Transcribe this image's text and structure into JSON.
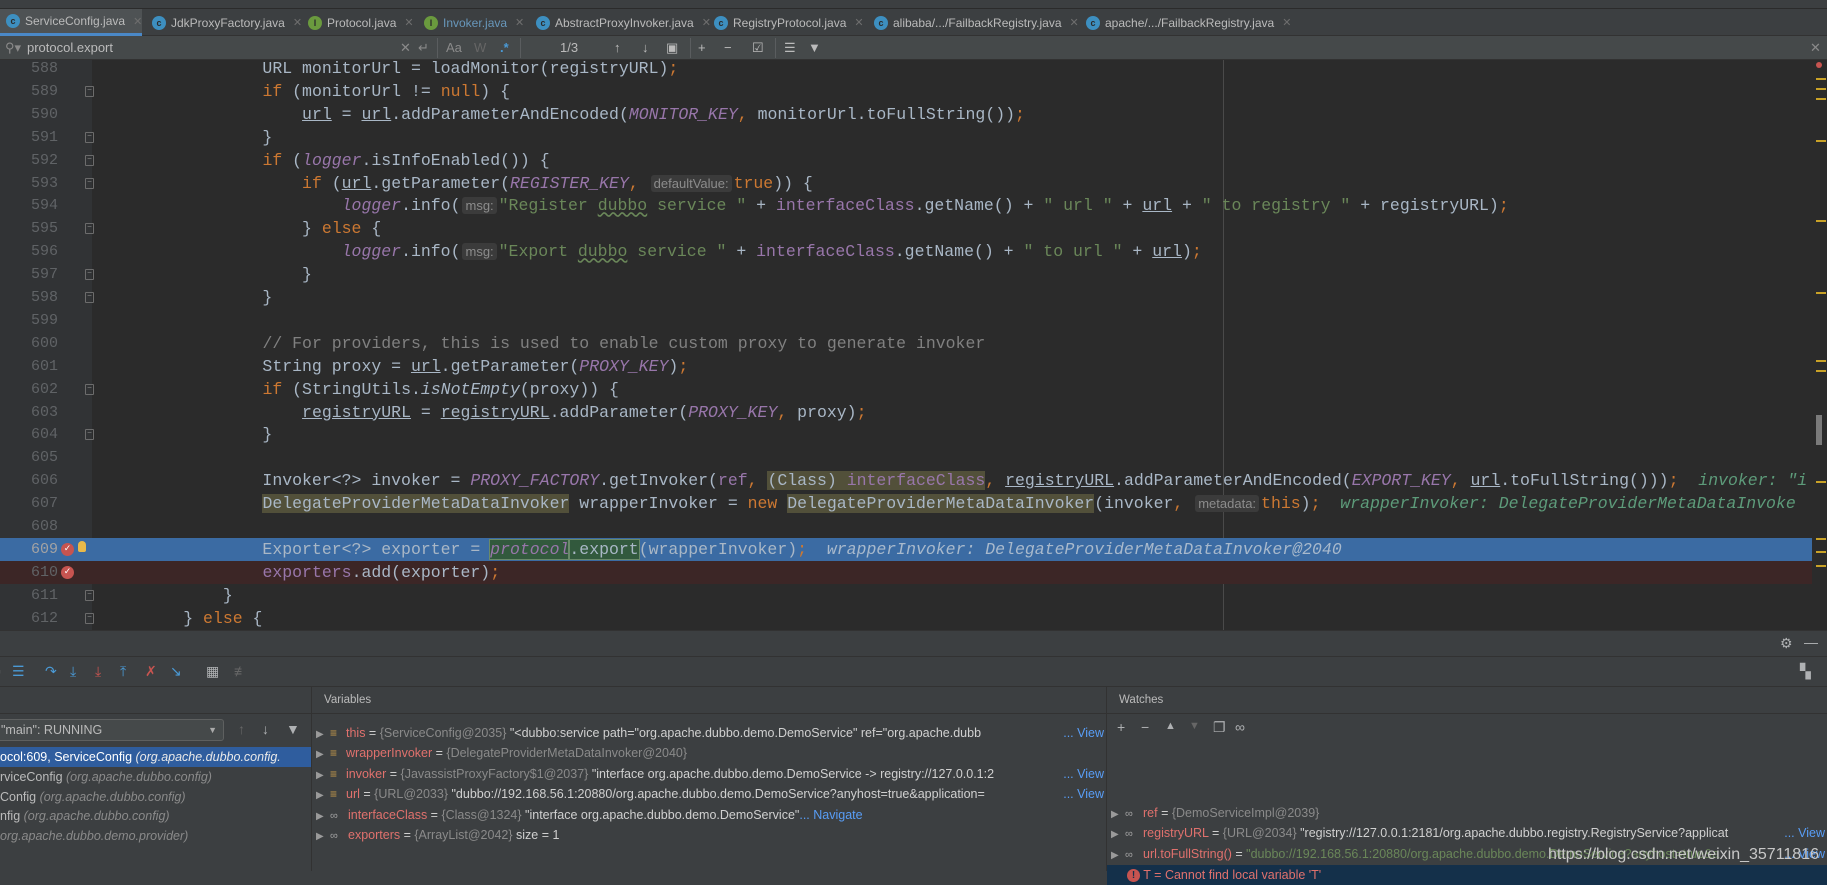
{
  "tabs": [
    {
      "label": "ServiceConfig.java",
      "icon": "c",
      "active": true
    },
    {
      "label": "JdkProxyFactory.java",
      "icon": "c"
    },
    {
      "label": "Protocol.java",
      "icon": "i"
    },
    {
      "label": "Invoker.java",
      "icon": "i",
      "modified": true
    },
    {
      "label": "AbstractProxyInvoker.java",
      "icon": "c"
    },
    {
      "label": "RegistryProtocol.java",
      "icon": "c"
    },
    {
      "label": "alibaba/.../FailbackRegistry.java",
      "icon": "c"
    },
    {
      "label": "apache/.../FailbackRegistry.java",
      "icon": "c"
    }
  ],
  "search": {
    "query": "protocol.export",
    "match_case": "Aa",
    "words": "W",
    "regex": ".*",
    "counter": "1/3"
  },
  "editor": {
    "lines": [
      {
        "n": "588",
        "t": [
          [
            "",
            "                URL monitorUrl = loadMonitor(registryURL)"
          ],
          [
            "kw",
            ";"
          ]
        ]
      },
      {
        "n": "589",
        "fold": true,
        "t": [
          [
            "",
            "                "
          ],
          [
            "kw",
            "if"
          ],
          [
            "",
            " (monitorUrl != "
          ],
          [
            "kw",
            "null"
          ],
          [
            "",
            ") {"
          ]
        ]
      },
      {
        "n": "590",
        "t": [
          [
            "",
            "                    "
          ],
          [
            "u",
            "url"
          ],
          [
            "",
            " = "
          ],
          [
            "u",
            "url"
          ],
          [
            "",
            ".addParameterAndEncoded("
          ],
          [
            "st",
            "MONITOR_KEY"
          ],
          [
            "kw",
            ", "
          ],
          [
            "",
            "monitorUrl.toFullString())"
          ],
          [
            "kw",
            ";"
          ]
        ]
      },
      {
        "n": "591",
        "fold": true,
        "t": [
          [
            "",
            "                }"
          ]
        ]
      },
      {
        "n": "592",
        "fold": true,
        "t": [
          [
            "",
            "                "
          ],
          [
            "kw",
            "if"
          ],
          [
            "",
            " ("
          ],
          [
            "st",
            "logger"
          ],
          [
            "",
            ".isInfoEnabled()) {"
          ]
        ]
      },
      {
        "n": "593",
        "fold": true,
        "t": [
          [
            "",
            "                    "
          ],
          [
            "kw",
            "if"
          ],
          [
            "",
            " ("
          ],
          [
            "u",
            "url"
          ],
          [
            "",
            ".getParameter("
          ],
          [
            "st",
            "REGISTER_KEY"
          ],
          [
            "kw",
            ", "
          ],
          [
            "hint",
            "defaultValue:"
          ],
          [
            "kw",
            "true"
          ],
          [
            "",
            ")) {"
          ]
        ]
      },
      {
        "n": "594",
        "t": [
          [
            "",
            "                        "
          ],
          [
            "st",
            "logger"
          ],
          [
            "",
            ".info("
          ],
          [
            "hint",
            "msg:"
          ],
          [
            "str",
            "\"Register "
          ],
          [
            "strw",
            "dubbo"
          ],
          [
            "str",
            " service \""
          ],
          [
            "",
            " + "
          ],
          [
            "f",
            "interfaceClass"
          ],
          [
            "",
            ".getName() + "
          ],
          [
            "str",
            "\" url \""
          ],
          [
            "",
            " + "
          ],
          [
            "u",
            "url"
          ],
          [
            "",
            " + "
          ],
          [
            "str",
            "\" to registry \""
          ],
          [
            "",
            " + registryURL)"
          ],
          [
            "kw",
            ";"
          ]
        ]
      },
      {
        "n": "595",
        "fold": true,
        "t": [
          [
            "",
            "                    } "
          ],
          [
            "kw",
            "else"
          ],
          [
            "",
            " {"
          ]
        ]
      },
      {
        "n": "596",
        "t": [
          [
            "",
            "                        "
          ],
          [
            "st",
            "logger"
          ],
          [
            "",
            ".info("
          ],
          [
            "hint",
            "msg:"
          ],
          [
            "str",
            "\"Export "
          ],
          [
            "strw",
            "dubbo"
          ],
          [
            "str",
            " service \""
          ],
          [
            "",
            " + "
          ],
          [
            "f",
            "interfaceClass"
          ],
          [
            "",
            ".getName() + "
          ],
          [
            "str",
            "\" to url \""
          ],
          [
            "",
            " + "
          ],
          [
            "u",
            "url"
          ],
          [
            "",
            ")"
          ],
          [
            "kw",
            ";"
          ]
        ]
      },
      {
        "n": "597",
        "fold": true,
        "t": [
          [
            "",
            "                    }"
          ]
        ]
      },
      {
        "n": "598",
        "fold": true,
        "t": [
          [
            "",
            "                }"
          ]
        ]
      },
      {
        "n": "599",
        "t": []
      },
      {
        "n": "600",
        "t": [
          [
            "",
            "                "
          ],
          [
            "cmt",
            "// For providers, this is used to enable custom proxy to generate invoker"
          ]
        ]
      },
      {
        "n": "601",
        "t": [
          [
            "",
            "                String proxy = "
          ],
          [
            "u",
            "url"
          ],
          [
            "",
            ".getParameter("
          ],
          [
            "st",
            "PROXY_KEY"
          ],
          [
            "",
            ")"
          ],
          [
            "kw",
            ";"
          ]
        ]
      },
      {
        "n": "602",
        "fold": true,
        "t": [
          [
            "",
            "                "
          ],
          [
            "kw",
            "if"
          ],
          [
            "",
            " (StringUtils."
          ],
          [
            "it",
            "isNotEmpty"
          ],
          [
            "",
            "(proxy)) {"
          ]
        ]
      },
      {
        "n": "603",
        "t": [
          [
            "",
            "                    "
          ],
          [
            "u",
            "registryURL"
          ],
          [
            "",
            " = "
          ],
          [
            "u",
            "registryURL"
          ],
          [
            "",
            ".addParameter("
          ],
          [
            "st",
            "PROXY_KEY"
          ],
          [
            "kw",
            ", "
          ],
          [
            "",
            "proxy)"
          ],
          [
            "kw",
            ";"
          ]
        ]
      },
      {
        "n": "604",
        "fold": true,
        "t": [
          [
            "",
            "                }"
          ]
        ]
      },
      {
        "n": "605",
        "t": []
      },
      {
        "n": "606",
        "t": [
          [
            "",
            "                Invoker<?> invoker = "
          ],
          [
            "st",
            "PROXY_FACTORY"
          ],
          [
            "",
            ".getInvoker("
          ],
          [
            "f",
            "ref"
          ],
          [
            "kw",
            ", "
          ],
          [
            "hl",
            "(Class) "
          ],
          [
            "hlf",
            "interfaceClass"
          ],
          [
            "kw",
            ", "
          ],
          [
            "u",
            "registryURL"
          ],
          [
            "",
            ".addParameterAndEncoded("
          ],
          [
            "st",
            "EXPORT_KEY"
          ],
          [
            "kw",
            ", "
          ],
          [
            "u",
            "url"
          ],
          [
            "",
            ".toFullString()))"
          ],
          [
            "kw",
            ";"
          ],
          [
            "dbg",
            "  invoker: \"i"
          ]
        ]
      },
      {
        "n": "607",
        "t": [
          [
            "",
            "                "
          ],
          [
            "hl",
            "DelegateProviderMetaDataInvoker"
          ],
          [
            "",
            " wrapperInvoker = "
          ],
          [
            "kw",
            "new "
          ],
          [
            "hl",
            "DelegateProviderMetaDataInvoker"
          ],
          [
            "",
            "(invoker"
          ],
          [
            "kw",
            ", "
          ],
          [
            "hint",
            "metadata:"
          ],
          [
            "kw",
            "this"
          ],
          [
            "",
            ")"
          ],
          [
            "kw",
            ";"
          ],
          [
            "dbg",
            "  wrapperInvoker: DelegateProviderMetaDataInvoke"
          ]
        ]
      },
      {
        "n": "608",
        "t": []
      },
      {
        "n": "609",
        "state": "exec",
        "bp": true,
        "bulb": true,
        "t": [
          [
            "",
            "                Exporter<?> exporter = "
          ],
          [
            "foundst",
            "protocol"
          ],
          [
            "found",
            ".export"
          ],
          [
            "",
            "(wrapperInvoker)"
          ],
          [
            "kw",
            ";"
          ],
          [
            "dbg",
            "  wrapperInvoker: DelegateProviderMetaDataInvoker@2040"
          ]
        ]
      },
      {
        "n": "610",
        "state": "bp",
        "bp": true,
        "t": [
          [
            "",
            "                "
          ],
          [
            "f",
            "exporters"
          ],
          [
            "",
            ".add(exporter)"
          ],
          [
            "kw",
            ";"
          ]
        ]
      },
      {
        "n": "611",
        "fold": true,
        "t": [
          [
            "",
            "            }"
          ]
        ]
      },
      {
        "n": "612",
        "fold": true,
        "t": [
          [
            "",
            "        } "
          ],
          [
            "kw",
            "else"
          ],
          [
            "",
            " {"
          ]
        ]
      }
    ]
  },
  "debugger": {
    "frames_header": "",
    "thread": "\"main\": RUNNING",
    "frames": [
      {
        "loc": "ocol:609, ServiceConfig",
        "pkg": "(org.apache.dubbo.config.",
        "selected": true
      },
      {
        "loc": "rviceConfig",
        "pkg": "(org.apache.dubbo.config)"
      },
      {
        "loc": "Config",
        "pkg": "(org.apache.dubbo.config)"
      },
      {
        "loc": "nfig",
        "pkg": "(org.apache.dubbo.config)"
      },
      {
        "loc": "",
        "pkg": "org.apache.dubbo.demo.provider)"
      }
    ],
    "variables_title": "Variables",
    "variables": [
      {
        "name": "this",
        "type": "{ServiceConfig@2035}",
        "value": "\"<dubbo:service path=\"org.apache.dubbo.demo.DemoService\" ref=\"org.apache.dubb",
        "link": "... View",
        "icon": "field"
      },
      {
        "name": "wrapperInvoker",
        "type": "{DelegateProviderMetaDataInvoker@2040}",
        "value": "",
        "link": "",
        "icon": "field"
      },
      {
        "name": "invoker",
        "type": "{JavassistProxyFactory$1@2037}",
        "value": "\"interface org.apache.dubbo.demo.DemoService -> registry://127.0.0.1:2",
        "link": "... View",
        "icon": "field"
      },
      {
        "name": "url",
        "type": "{URL@2033}",
        "value": "\"dubbo://192.168.56.1:20880/org.apache.dubbo.demo.DemoService?anyhost=true&application=",
        "link": "... View",
        "icon": "field"
      },
      {
        "name": "interfaceClass",
        "type": "{Class@1324}",
        "value": "\"interface org.apache.dubbo.demo.DemoService\"",
        "link": "... Navigate",
        "icon": "watch"
      },
      {
        "name": "exporters",
        "type": "{ArrayList@2042}",
        "value": " size = 1",
        "link": "",
        "icon": "watch"
      }
    ],
    "watches_title": "Watches",
    "watches": [
      {
        "name": "ref",
        "type": "{DemoServiceImpl@2039}",
        "value": "",
        "link": ""
      },
      {
        "name": "registryURL",
        "type": "{URL@2034}",
        "value": "\"registry://127.0.0.1:2181/org.apache.dubbo.registry.RegistryService?applicat",
        "link": "... View"
      },
      {
        "name": "url.toFullString()",
        "type": "",
        "value": "\"dubbo://192.168.56.1:20880/org.apache.dubbo.demo.DemoService?anyhost=true&a",
        "link": "... View",
        "green": true
      }
    ],
    "watch_error": {
      "name": "T",
      "message": "Cannot find local variable 'T'"
    }
  },
  "watermark": "https://blog.csdn.net/weixin_35711816",
  "colors": {
    "exec_line": "#3b6ba3",
    "breakpoint_line": "#3c2626",
    "keyword": "#cc7832",
    "field": "#9876aa",
    "string": "#6a8759",
    "accent": "#4a88c7"
  }
}
